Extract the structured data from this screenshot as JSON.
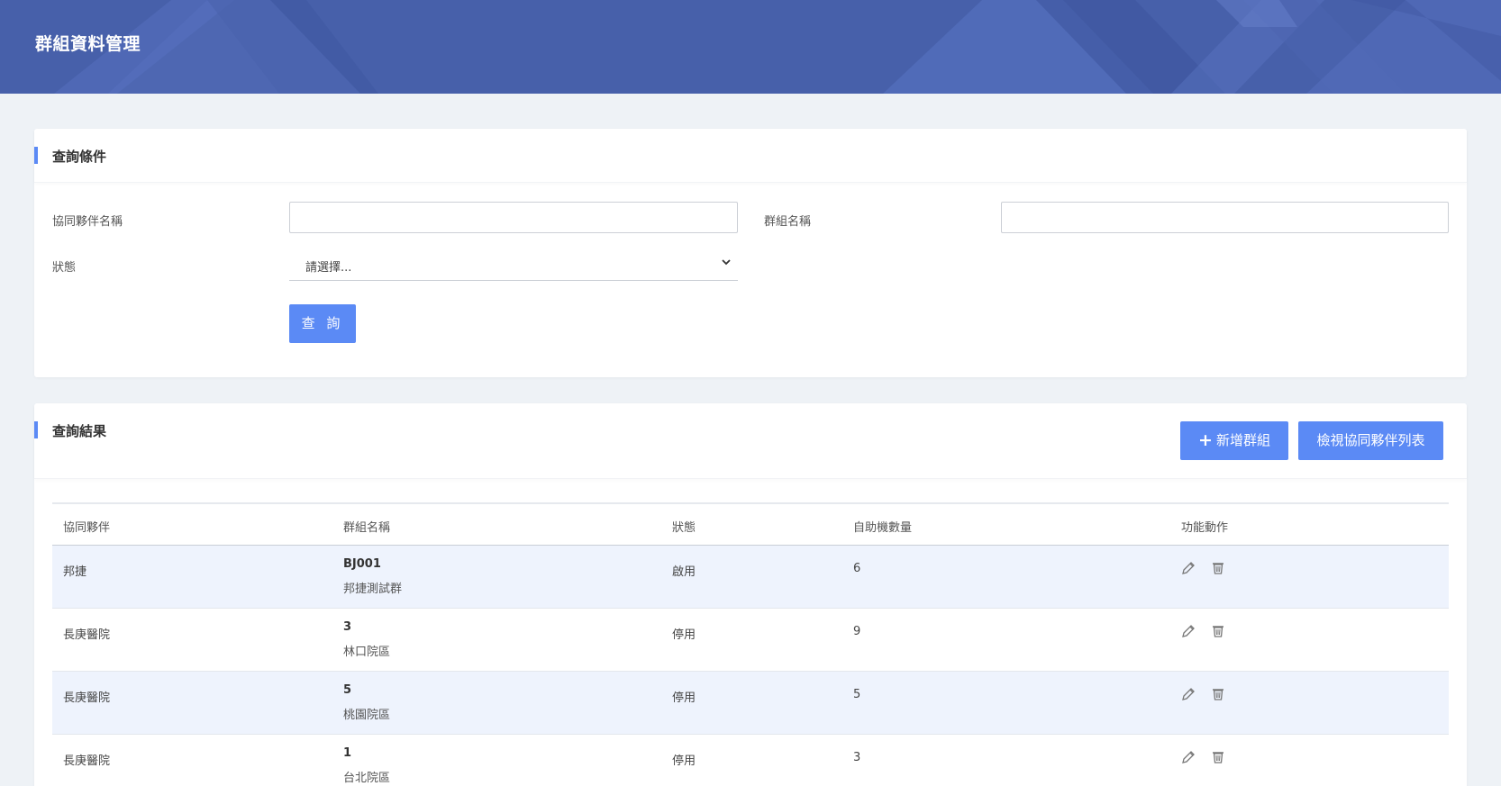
{
  "header": {
    "title": "群組資料管理"
  },
  "query": {
    "section_title": "查詢條件",
    "partner_label": "協同夥伴名稱",
    "partner_value": "",
    "group_label": "群組名稱",
    "group_value": "",
    "status_label": "狀態",
    "status_selected": "請選擇...",
    "query_button": "查 詢"
  },
  "results": {
    "section_title": "查詢結果",
    "add_button": "新增群組",
    "view_partners_button": "檢視協同夥伴列表",
    "columns": [
      "協同夥伴",
      "群組名稱",
      "狀態",
      "自助機數量",
      "功能動作"
    ],
    "rows": [
      {
        "partner": "邦捷",
        "code": "BJ001",
        "name": "邦捷測試群",
        "status": "啟用",
        "count": "6"
      },
      {
        "partner": "長庚醫院",
        "code": "3",
        "name": "林口院區",
        "status": "停用",
        "count": "9"
      },
      {
        "partner": "長庚醫院",
        "code": "5",
        "name": "桃園院區",
        "status": "停用",
        "count": "5"
      },
      {
        "partner": "長庚醫院",
        "code": "1",
        "name": "台北院區",
        "status": "停用",
        "count": "3"
      }
    ]
  },
  "icons": {
    "edit": "pencil-icon",
    "delete": "trash-icon",
    "dropdown": "chevron-down-icon",
    "add": "plus-icon"
  },
  "colors": {
    "header": "#4760aa",
    "accent": "#5b8af5",
    "row_alt": "#eef3fd",
    "page_bg": "#eef2f6"
  }
}
